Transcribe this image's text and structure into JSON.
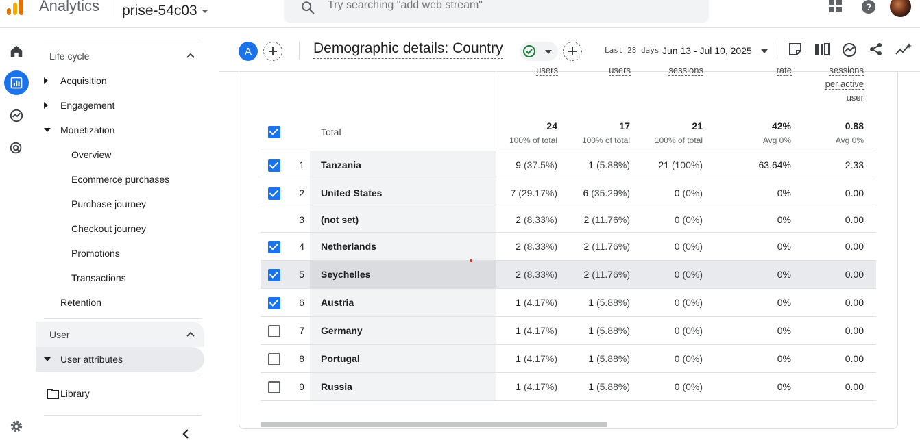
{
  "header": {
    "app_name": "Analytics",
    "property": "prise-54c03",
    "search_placeholder": "Try searching \"add web stream\""
  },
  "nav": {
    "lifecycle_label": "Life cycle",
    "items": [
      {
        "label": "Acquisition"
      },
      {
        "label": "Engagement"
      },
      {
        "label": "Monetization"
      },
      {
        "label": "Overview"
      },
      {
        "label": "Ecommerce purchases"
      },
      {
        "label": "Purchase journey"
      },
      {
        "label": "Checkout journey"
      },
      {
        "label": "Promotions"
      },
      {
        "label": "Transactions"
      },
      {
        "label": "Retention"
      }
    ],
    "user_label": "User",
    "user_attributes": "User attributes",
    "library": "Library"
  },
  "report": {
    "comparison_badge": "A",
    "title": "Demographic details: Country",
    "date_label": "Last 28 days",
    "date_range": "Jun 13 - Jul 10, 2025"
  },
  "table": {
    "columns": [
      {
        "label": "users"
      },
      {
        "label": "users"
      },
      {
        "label": "sessions"
      },
      {
        "label": "rate"
      },
      {
        "label_lines": [
          "sessions",
          "per active",
          "user"
        ]
      }
    ],
    "total": {
      "label": "Total",
      "values": [
        "24",
        "17",
        "21",
        "42%",
        "0.88"
      ],
      "subs": [
        "100% of total",
        "100% of total",
        "100% of total",
        "Avg 0%",
        "Avg 0%"
      ]
    },
    "rows": [
      {
        "n": "1",
        "country": "Tanzania",
        "checked": true,
        "c1": "9",
        "p1": "(37.5%)",
        "c2": "1",
        "p2": "(5.88%)",
        "c3": "21",
        "p3": "(100%)",
        "c4": "63.64%",
        "c5": "2.33"
      },
      {
        "n": "2",
        "country": "United States",
        "checked": true,
        "c1": "7",
        "p1": "(29.17%)",
        "c2": "6",
        "p2": "(35.29%)",
        "c3": "0",
        "p3": "(0%)",
        "c4": "0%",
        "c5": "0.00"
      },
      {
        "n": "3",
        "country": "(not set)",
        "checked": null,
        "c1": "2",
        "p1": "(8.33%)",
        "c2": "2",
        "p2": "(11.76%)",
        "c3": "0",
        "p3": "(0%)",
        "c4": "0%",
        "c5": "0.00"
      },
      {
        "n": "4",
        "country": "Netherlands",
        "checked": true,
        "c1": "2",
        "p1": "(8.33%)",
        "c2": "2",
        "p2": "(11.76%)",
        "c3": "0",
        "p3": "(0%)",
        "c4": "0%",
        "c5": "0.00"
      },
      {
        "n": "5",
        "country": "Seychelles",
        "checked": true,
        "c1": "2",
        "p1": "(8.33%)",
        "c2": "2",
        "p2": "(11.76%)",
        "c3": "0",
        "p3": "(0%)",
        "c4": "0%",
        "c5": "0.00"
      },
      {
        "n": "6",
        "country": "Austria",
        "checked": true,
        "c1": "1",
        "p1": "(4.17%)",
        "c2": "1",
        "p2": "(5.88%)",
        "c3": "0",
        "p3": "(0%)",
        "c4": "0%",
        "c5": "0.00"
      },
      {
        "n": "7",
        "country": "Germany",
        "checked": false,
        "c1": "1",
        "p1": "(4.17%)",
        "c2": "1",
        "p2": "(5.88%)",
        "c3": "0",
        "p3": "(0%)",
        "c4": "0%",
        "c5": "0.00"
      },
      {
        "n": "8",
        "country": "Portugal",
        "checked": false,
        "c1": "1",
        "p1": "(4.17%)",
        "c2": "1",
        "p2": "(5.88%)",
        "c3": "0",
        "p3": "(0%)",
        "c4": "0%",
        "c5": "0.00"
      },
      {
        "n": "9",
        "country": "Russia",
        "checked": false,
        "c1": "1",
        "p1": "(4.17%)",
        "c2": "1",
        "p2": "(5.88%)",
        "c3": "0",
        "p3": "(0%)",
        "c4": "0%",
        "c5": "0.00"
      }
    ]
  },
  "colors": {
    "accent": "#1a73e8",
    "highlight_row": "#e8eaed",
    "status_green": "#188038"
  }
}
